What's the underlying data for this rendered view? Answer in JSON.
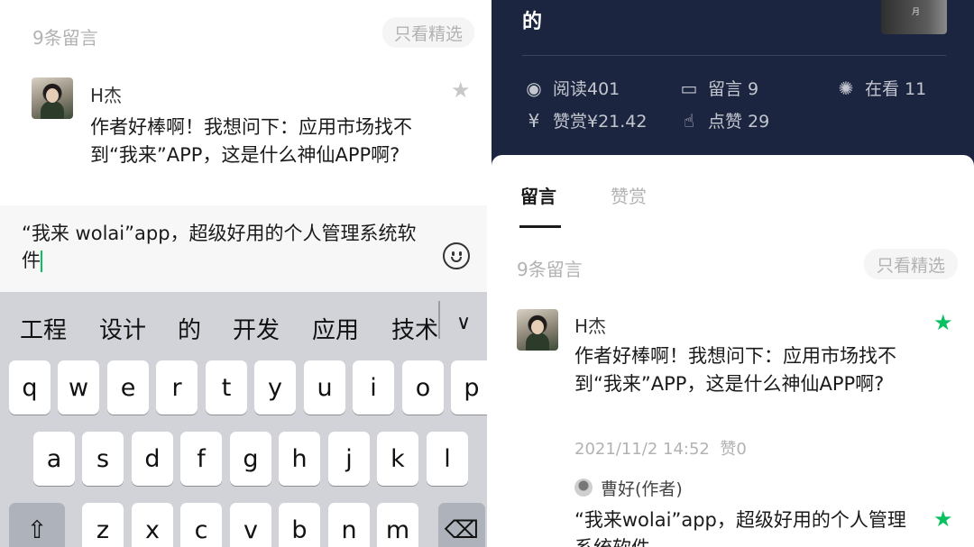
{
  "left": {
    "comment_count": "9条留言",
    "filter_button": "只看精选",
    "comment": {
      "author": "H杰",
      "text": "作者好棒啊！我想问下：应用市场找不到“我来”APP，这是什么神仙APP啊?"
    },
    "input_text": "“我来 wolai”app，超级好用的个人管理系统软件",
    "candidates": [
      "工程",
      "设计",
      "的",
      "开发",
      "应用",
      "技术"
    ],
    "keys_row1": [
      "q",
      "w",
      "e",
      "r",
      "t",
      "y",
      "u",
      "i",
      "o",
      "p"
    ],
    "keys_row2": [
      "a",
      "s",
      "d",
      "f",
      "g",
      "h",
      "j",
      "k",
      "l"
    ],
    "keys_row3": [
      "z",
      "x",
      "c",
      "v",
      "b",
      "n",
      "m"
    ],
    "icons": {
      "shift": "⇧",
      "backspace": "⌫",
      "collapse": "∨",
      "star": "★"
    }
  },
  "right": {
    "title_fragment": "的",
    "thumb_text": "月",
    "stats": {
      "read": "阅读401",
      "comments": "留言 9",
      "watching": "在看 11",
      "reward": "赞赏¥21.42",
      "likes": "点赞 29"
    },
    "tabs": {
      "active": "留言",
      "other": "赞赏"
    },
    "comment_count": "9条留言",
    "filter_button": "只看精选",
    "comment": {
      "author": "H杰",
      "text": "作者好棒啊！我想问下：应用市场找不到“我来”APP，这是什么神仙APP啊?",
      "time": "2021/11/2 14:52",
      "likes": "赞0"
    },
    "reply": {
      "author": "曹好(作者)",
      "text": "“我来wolai”app，超级好用的个人管理系统软件"
    }
  },
  "colors": {
    "accent_green": "#07c160",
    "dark_header": "#1b2540",
    "keyboard_bg": "#d1d3d9"
  }
}
